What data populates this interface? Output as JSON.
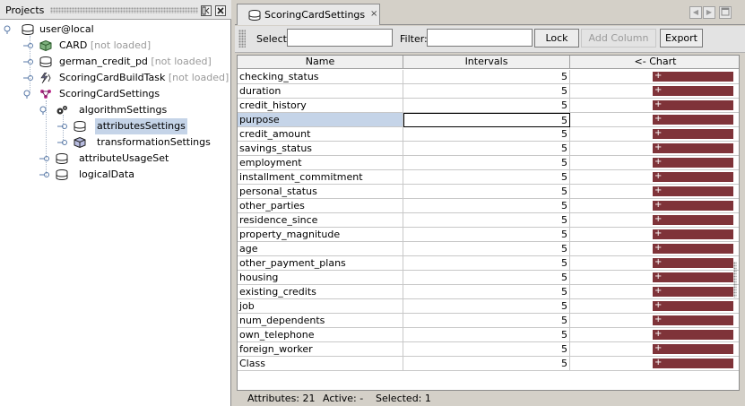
{
  "projects": {
    "title": "Projects",
    "tree": [
      {
        "label": "user@local",
        "note": ""
      },
      {
        "label": "CARD",
        "note": "[not loaded]"
      },
      {
        "label": "german_credit_pd",
        "note": "[not loaded]"
      },
      {
        "label": "ScoringCardBuildTask",
        "note": "[not loaded]"
      },
      {
        "label": "ScoringCardSettings",
        "note": ""
      },
      {
        "label": "algorithmSettings",
        "note": ""
      },
      {
        "label": "attributesSettings",
        "note": ""
      },
      {
        "label": "transformationSettings",
        "note": ""
      },
      {
        "label": "attributeUsageSet",
        "note": ""
      },
      {
        "label": "logicalData",
        "note": ""
      }
    ]
  },
  "editor": {
    "tab_title": "ScoringCardSettings",
    "tab_close": "×"
  },
  "toolbar": {
    "select_label": "Select:",
    "select_value": "",
    "filter_label": "Filter:",
    "filter_value": "",
    "lock_label": "Lock",
    "add_column_label": "Add Column",
    "export_label": "Export"
  },
  "table": {
    "columns": [
      "Name",
      "Intervals",
      "<- Chart"
    ],
    "bar_label": "+",
    "rows": [
      {
        "name": "checking_status",
        "intervals": "5"
      },
      {
        "name": "duration",
        "intervals": "5"
      },
      {
        "name": "credit_history",
        "intervals": "5"
      },
      {
        "name": "purpose",
        "intervals": "5"
      },
      {
        "name": "credit_amount",
        "intervals": "5"
      },
      {
        "name": "savings_status",
        "intervals": "5"
      },
      {
        "name": "employment",
        "intervals": "5"
      },
      {
        "name": "installment_commitment",
        "intervals": "5"
      },
      {
        "name": "personal_status",
        "intervals": "5"
      },
      {
        "name": "other_parties",
        "intervals": "5"
      },
      {
        "name": "residence_since",
        "intervals": "5"
      },
      {
        "name": "property_magnitude",
        "intervals": "5"
      },
      {
        "name": "age",
        "intervals": "5"
      },
      {
        "name": "other_payment_plans",
        "intervals": "5"
      },
      {
        "name": "housing",
        "intervals": "5"
      },
      {
        "name": "existing_credits",
        "intervals": "5"
      },
      {
        "name": "job",
        "intervals": "5"
      },
      {
        "name": "num_dependents",
        "intervals": "5"
      },
      {
        "name": "own_telephone",
        "intervals": "5"
      },
      {
        "name": "foreign_worker",
        "intervals": "5"
      },
      {
        "name": "Class",
        "intervals": "5"
      }
    ]
  },
  "status": {
    "attributes": "Attributes: 21",
    "active": "Active: -",
    "selected": "Selected: 1"
  },
  "colors": {
    "bar": "#7f3339",
    "selection": "#c5d4e8"
  }
}
